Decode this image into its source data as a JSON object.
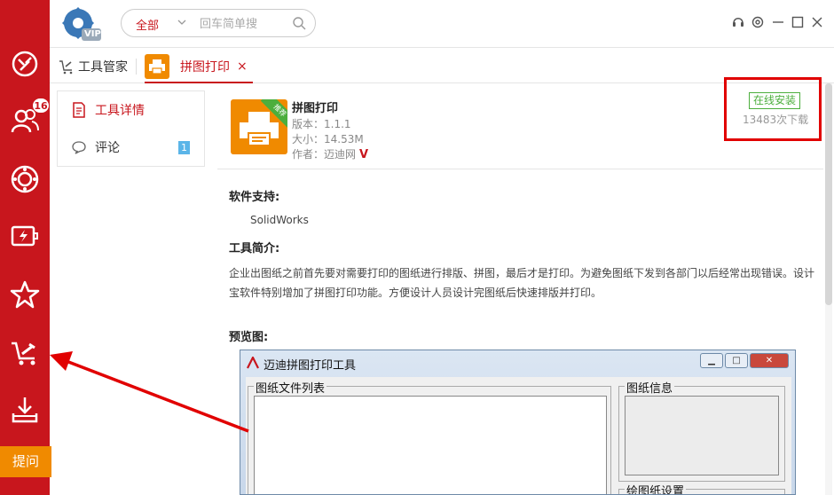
{
  "sidebar": {
    "badge_count": "16",
    "items": [
      "design-icon",
      "users-icon",
      "gear-ring-icon",
      "battery-icon",
      "star-icon",
      "tools-cart-icon",
      "download-tray-icon"
    ],
    "ask_label": "提问"
  },
  "topbar": {
    "logo_vip": "VIP",
    "search_scope": "全部",
    "search_placeholder": "回车简单搜"
  },
  "tabs": {
    "home_label": "工具管家",
    "active_label": "拼图打印",
    "close_label": "×"
  },
  "leftnav": {
    "items": [
      {
        "label": "工具详情"
      },
      {
        "label": "评论",
        "count": "1"
      }
    ]
  },
  "app": {
    "name": "拼图打印",
    "ribbon": "推荐",
    "version": "版本：1.1.1",
    "size": "大小：14.53M",
    "author": "作者：迈迪网",
    "author_badge": "V",
    "install_label": "在线安装",
    "downloads": "13483次下载"
  },
  "details": {
    "support_heading": "软件支持:",
    "support_value": "SolidWorks",
    "intro_heading": "工具简介:",
    "intro_text": "企业出图纸之前首先要对需要打印的图纸进行排版、拼图，最后才是打印。为避免图纸下发到各部门以后经常出现错误。设计宝软件特别增加了拼图打印功能。方便设计人员设计完图纸后快速排版并打印。",
    "preview_heading": "预览图:"
  },
  "preview_window": {
    "title": "迈迪拼图打印工具",
    "group_files": "图纸文件列表",
    "group_info": "图纸信息",
    "group_settings": "绘图纸设置"
  },
  "colors": {
    "brand_red": "#c8161d",
    "accent_orange": "#f08a00",
    "install_green": "#4cae3d"
  }
}
